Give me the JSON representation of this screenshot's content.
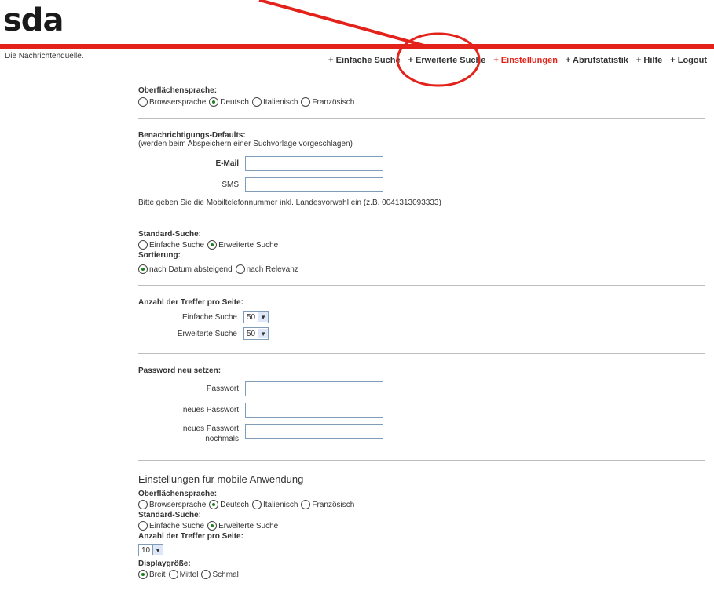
{
  "header": {
    "logo": "sda",
    "tagline": "Die Nachrichtenquelle.",
    "nav": [
      {
        "label": "+ Einfache Suche",
        "active": false
      },
      {
        "label": "+ Erweiterte Suche",
        "active": false
      },
      {
        "label": "+ Einstellungen",
        "active": true
      },
      {
        "label": "+ Abrufstatistik",
        "active": false
      },
      {
        "label": "+ Hilfe",
        "active": false
      },
      {
        "label": "+ Logout",
        "active": false
      }
    ]
  },
  "sections": {
    "language": {
      "heading": "Oberflächensprache:",
      "options": [
        "Browsersprache",
        "Deutsch",
        "Italienisch",
        "Französisch"
      ],
      "selected": "Deutsch"
    },
    "notify": {
      "heading": "Benachrichtigungs-Defaults:",
      "subheading": "(werden beim Abspeichern einer Suchvorlage vorgeschlagen)",
      "email_label": "E-Mail",
      "email_value": "",
      "sms_label": "SMS",
      "sms_value": "",
      "note": "Bitte geben Sie die Mobiltelefonnummer inkl. Landesvorwahl ein (z.B. 0041313093333)"
    },
    "search": {
      "heading": "Standard-Suche:",
      "options": [
        "Einfache Suche",
        "Erweiterte Suche"
      ],
      "selected": "Erweiterte Suche",
      "sort_heading": "Sortierung:",
      "sort_options": [
        "nach Datum absteigend",
        "nach Relevanz"
      ],
      "sort_selected": "nach Datum absteigend"
    },
    "hits": {
      "heading": "Anzahl der Treffer pro Seite:",
      "simple_label": "Einfache Suche",
      "simple_value": "50",
      "advanced_label": "Erweiterte Suche",
      "advanced_value": "50"
    },
    "password": {
      "heading": "Password neu setzen:",
      "pw_label": "Passwort",
      "new_label": "neues Passwort",
      "repeat_label_1": "neues Passwort",
      "repeat_label_2": "nochmals"
    },
    "mobile": {
      "title": "Einstellungen für mobile Anwendung",
      "lang_heading": "Oberflächensprache:",
      "lang_options": [
        "Browsersprache",
        "Deutsch",
        "Italienisch",
        "Französisch"
      ],
      "lang_selected": "Deutsch",
      "search_heading": "Standard-Suche:",
      "search_options": [
        "Einfache Suche",
        "Erweiterte Suche"
      ],
      "search_selected": "Erweiterte Suche",
      "hits_heading": "Anzahl der Treffer pro Seite:",
      "hits_value": "10",
      "display_heading": "Displaygröße:",
      "display_options": [
        "Breit",
        "Mittel",
        "Schmal"
      ],
      "display_selected": "Breit"
    }
  },
  "colors": {
    "accent": "#e3231b",
    "radio_selected": "#1e7f1e",
    "annotation": "#e3231b"
  },
  "icons": {
    "dropdown": "chevron-down-icon",
    "annotation": "annotation-arrow-icon"
  }
}
